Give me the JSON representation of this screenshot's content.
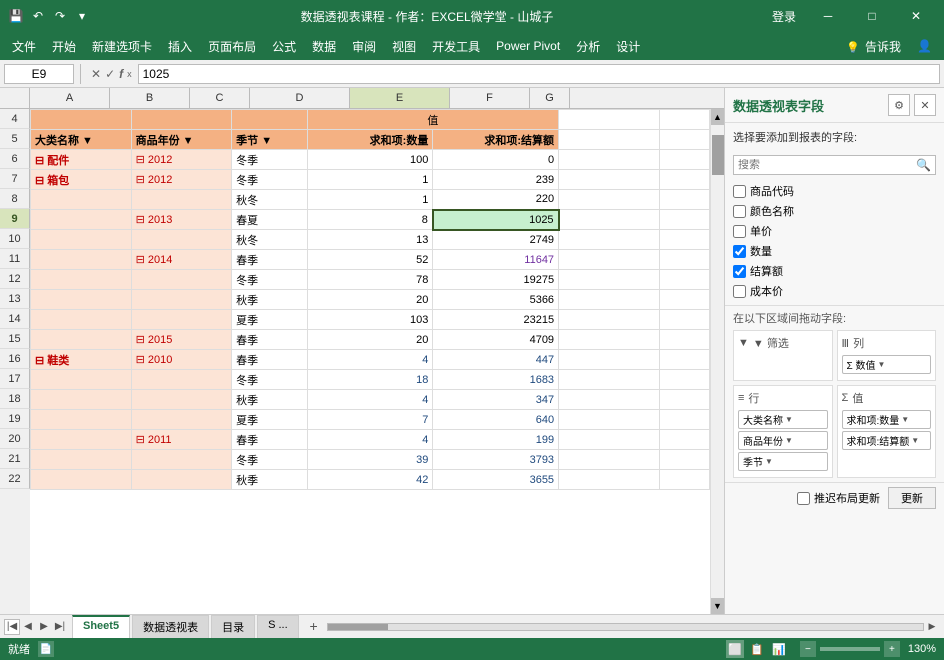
{
  "titlebar": {
    "title": "数据透视表课程 - 作者：EXCEL微学堂 - 山城子",
    "login": "登录"
  },
  "menu": {
    "items": [
      "文件",
      "开始",
      "新建选项卡",
      "插入",
      "页面布局",
      "公式",
      "数据",
      "审阅",
      "视图",
      "开发工具",
      "Power Pivot",
      "分析",
      "设计"
    ]
  },
  "formulabar": {
    "cellref": "E9",
    "value": "1025"
  },
  "columns": {
    "labels": [
      "A",
      "B",
      "C",
      "D",
      "E",
      "F",
      "G"
    ],
    "widths": [
      80,
      80,
      60,
      80,
      100,
      80,
      40
    ]
  },
  "rows": {
    "start": 4,
    "numbers": [
      4,
      5,
      6,
      7,
      8,
      9,
      10,
      11,
      12,
      13,
      14,
      15,
      16,
      17,
      18,
      19,
      20,
      21,
      22
    ]
  },
  "tableheader": {
    "col_a": "大类名称",
    "col_b": "商品年份",
    "col_c": "季节",
    "val_label": "值",
    "col_d": "求和项:数量",
    "col_e": "求和项:结算额"
  },
  "tabledata": [
    {
      "row": 6,
      "a": "⊟ 配件",
      "b": "",
      "c": "",
      "d": "",
      "e": "",
      "merge_a": true
    },
    {
      "row": 6,
      "a": "⊟ 配件",
      "b": "⊟ 2012",
      "c": "冬季",
      "d": "100",
      "e": "0"
    },
    {
      "row": 7,
      "a": "⊟ 箱包",
      "b": "⊟ 2012",
      "c": "冬季",
      "d": "1",
      "e": "239"
    },
    {
      "row": 8,
      "a": "",
      "b": "",
      "c": "秋冬",
      "d": "1",
      "e": "220"
    },
    {
      "row": 9,
      "a": "",
      "b": "⊟ 2013",
      "c": "春夏",
      "d": "8",
      "e": "1025",
      "selected": true
    },
    {
      "row": 10,
      "a": "",
      "b": "",
      "c": "秋冬",
      "d": "13",
      "e": "2749"
    },
    {
      "row": 11,
      "a": "",
      "b": "⊟ 2014",
      "c": "春季",
      "d": "52",
      "e": "11647"
    },
    {
      "row": 12,
      "a": "",
      "b": "",
      "c": "冬季",
      "d": "78",
      "e": "19275"
    },
    {
      "row": 13,
      "a": "",
      "b": "",
      "c": "秋季",
      "d": "20",
      "e": "5366"
    },
    {
      "row": 14,
      "a": "",
      "b": "",
      "c": "夏季",
      "d": "103",
      "e": "23215"
    },
    {
      "row": 15,
      "a": "",
      "b": "⊟ 2015",
      "c": "春季",
      "d": "20",
      "e": "4709"
    },
    {
      "row": 16,
      "a": "⊟ 鞋类",
      "b": "⊟ 2010",
      "c": "春季",
      "d": "4",
      "e": "447"
    },
    {
      "row": 17,
      "a": "",
      "b": "",
      "c": "冬季",
      "d": "18",
      "e": "1683"
    },
    {
      "row": 18,
      "a": "",
      "b": "",
      "c": "秋季",
      "d": "4",
      "e": "347"
    },
    {
      "row": 19,
      "a": "",
      "b": "",
      "c": "夏季",
      "d": "7",
      "e": "640"
    },
    {
      "row": 20,
      "a": "",
      "b": "⊟ 2011",
      "c": "春季",
      "d": "4",
      "e": "199"
    },
    {
      "row": 21,
      "a": "",
      "b": "",
      "c": "冬季",
      "d": "39",
      "e": "3793"
    },
    {
      "row": 22,
      "a": "",
      "b": "",
      "c": "秋季",
      "d": "42",
      "e": "3655"
    }
  ],
  "rightpanel": {
    "title": "数据透视表字段",
    "subtitle": "选择要添加到报表的字段:",
    "search_placeholder": "搜索",
    "fields": [
      {
        "name": "商品代码",
        "checked": false
      },
      {
        "name": "颜色名称",
        "checked": false
      },
      {
        "name": "单价",
        "checked": false
      },
      {
        "name": "数量",
        "checked": true
      },
      {
        "name": "结算额",
        "checked": true
      },
      {
        "name": "成本价",
        "checked": false
      }
    ],
    "drag_title": "在以下区域间拖动字段:",
    "filter_label": "▼ 筛选",
    "col_label": "Ⅲ 列",
    "row_label": "≡ 行",
    "val_label": "Σ 值",
    "col_tags": [
      {
        "label": "Σ 数值",
        "arrow": "▼"
      }
    ],
    "row_tags": [
      {
        "label": "大类名称",
        "arrow": "▼"
      },
      {
        "label": "商品年份",
        "arrow": "▼"
      },
      {
        "label": "季节",
        "arrow": "▼"
      }
    ],
    "val_tags": [
      {
        "label": "求和项:数量",
        "arrow": "▼"
      },
      {
        "label": "求和项:结算额",
        "arrow": "▼"
      }
    ],
    "update_label": "推迟布局更新",
    "update_btn": "更新"
  },
  "sheettabs": {
    "active": "Sheet5",
    "tabs": [
      "Sheet5",
      "数据透视表",
      "目录",
      "S ..."
    ]
  },
  "statusbar": {
    "left": "就绪",
    "center": "",
    "zoom": "130%"
  }
}
